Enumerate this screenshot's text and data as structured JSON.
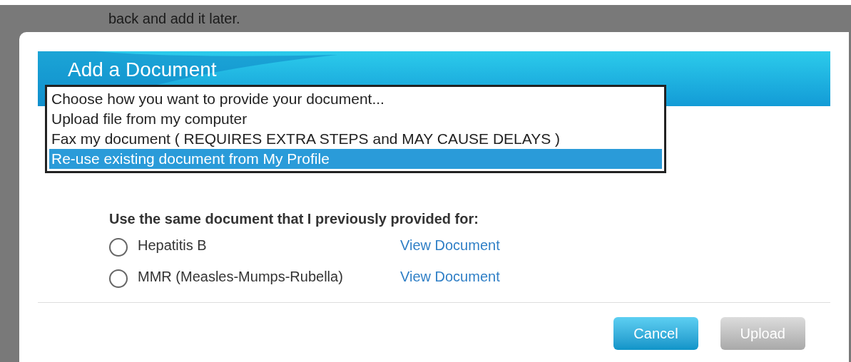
{
  "background_text": "back and add it later.",
  "dialog": {
    "title": "Add a Document",
    "dropdown": {
      "options": [
        {
          "label": "Choose how you want to provide your document...",
          "selected": false
        },
        {
          "label": "Upload file from my computer",
          "selected": false
        },
        {
          "label": "Fax my document ( REQUIRES EXTRA STEPS and MAY CAUSE DELAYS )",
          "selected": false
        },
        {
          "label": "Re-use existing document from My Profile",
          "selected": true
        }
      ]
    },
    "prompt": "Use the same document that I previously provided for:",
    "documents": [
      {
        "name": "Hepatitis B",
        "selected": false,
        "link": "View Document"
      },
      {
        "name": "MMR (Measles-Mumps-Rubella)",
        "selected": false,
        "link": "View Document"
      }
    ],
    "buttons": [
      {
        "label": "Cancel",
        "disabled": false
      },
      {
        "label": "Upload",
        "disabled": true
      }
    ]
  }
}
